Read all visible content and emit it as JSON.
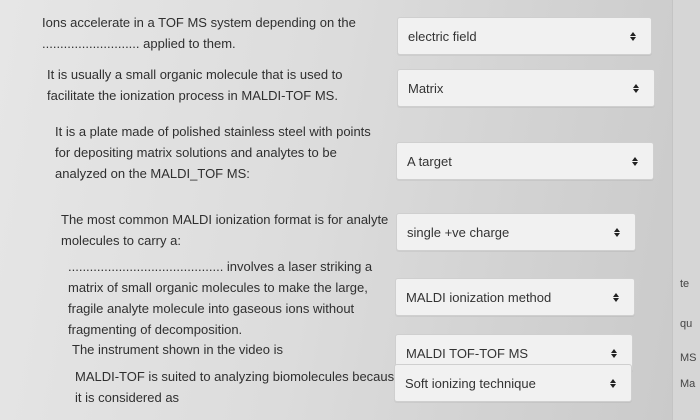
{
  "questions": [
    {
      "lines": [
        "Ions accelerate in a TOF MS system depending on the",
        "........................... applied to them."
      ],
      "answer": "electric field"
    },
    {
      "lines": [
        "It is usually a small organic molecule that is used to",
        "facilitate the ionization process in MALDI-TOF MS."
      ],
      "answer": "Matrix"
    },
    {
      "lines": [
        "It is a plate made of polished stainless steel with points",
        "for depositing matrix solutions and analytes to be",
        "analyzed on the MALDI_TOF MS:"
      ],
      "answer": "A target"
    },
    {
      "lines": [
        "The most common MALDI ionization format is for analyte",
        "molecules to carry a:"
      ],
      "answer": "single +ve charge"
    },
    {
      "lines": [
        "........................................... involves a laser striking a",
        "matrix of small organic molecules to make the large,",
        "fragile analyte molecule into gaseous ions without",
        "fragmenting of decomposition."
      ],
      "answer": "MALDI ionization method"
    },
    {
      "lines": [
        "The instrument shown in the video is"
      ],
      "answer": "MALDI TOF-TOF MS"
    },
    {
      "lines": [
        "MALDI-TOF is suited to analyzing biomolecules because",
        "it is considered as"
      ],
      "answer": "Soft ionizing technique"
    }
  ],
  "side_fragments": [
    "te",
    "qu",
    "MS",
    "Ma"
  ]
}
